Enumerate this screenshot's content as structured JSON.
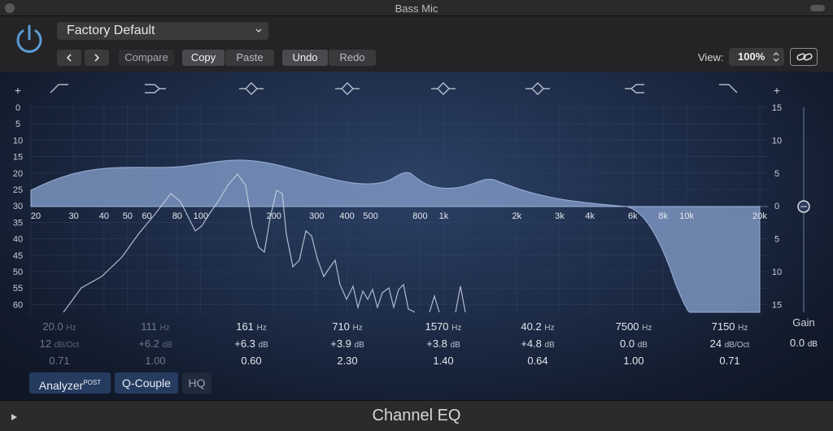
{
  "window": {
    "title": "Bass Mic"
  },
  "header": {
    "preset": "Factory Default",
    "compare": "Compare",
    "copy": "Copy",
    "paste": "Paste",
    "undo": "Undo",
    "redo": "Redo",
    "view_label": "View:",
    "view_value": "100%"
  },
  "left_scale": [
    "+",
    "0",
    "5",
    "10",
    "15",
    "20",
    "25",
    "30",
    "35",
    "40",
    "45",
    "50",
    "55",
    "60"
  ],
  "right_scale": [
    "+",
    "15",
    "10",
    "5",
    "0",
    "5",
    "10",
    "15"
  ],
  "freq_labels": [
    "20",
    "30",
    "40",
    "50",
    "60",
    "80",
    "100",
    "200",
    "300",
    "400",
    "500",
    "800",
    "1k",
    "2k",
    "3k",
    "4k",
    "6k",
    "8k",
    "10k",
    "20k"
  ],
  "bands": [
    {
      "freq": "20.0",
      "freq_unit": "Hz",
      "gain": "12",
      "gain_unit": "dB/Oct",
      "q": "0.71",
      "active": false
    },
    {
      "freq": "111",
      "freq_unit": "Hz",
      "gain": "+6.2",
      "gain_unit": "dB",
      "q": "1.00",
      "active": false
    },
    {
      "freq": "161",
      "freq_unit": "Hz",
      "gain": "+6.3",
      "gain_unit": "dB",
      "q": "0.60",
      "active": true
    },
    {
      "freq": "710",
      "freq_unit": "Hz",
      "gain": "+3.9",
      "gain_unit": "dB",
      "q": "2.30",
      "active": true
    },
    {
      "freq": "1570",
      "freq_unit": "Hz",
      "gain": "+3.8",
      "gain_unit": "dB",
      "q": "1.40",
      "active": true
    },
    {
      "freq": "40.2",
      "freq_unit": "Hz",
      "gain": "+4.8",
      "gain_unit": "dB",
      "q": "0.64",
      "active": true
    },
    {
      "freq": "7500",
      "freq_unit": "Hz",
      "gain": "0.0",
      "gain_unit": "dB",
      "q": "1.00",
      "active": true
    },
    {
      "freq": "7150",
      "freq_unit": "Hz",
      "gain": "24",
      "gain_unit": "dB/Oct",
      "q": "0.71",
      "active": true
    }
  ],
  "output": {
    "label": "Gain",
    "value": "0.0",
    "unit": "dB"
  },
  "options": {
    "analyzer": "Analyzer",
    "analyzer_sup": "POST",
    "q_couple": "Q-Couple",
    "hq": "HQ"
  },
  "plugin_name": "Channel EQ",
  "colors": {
    "accent": "#5b9bd5",
    "panel": "#1d2c48",
    "curve_fill": "#7b94bf"
  }
}
